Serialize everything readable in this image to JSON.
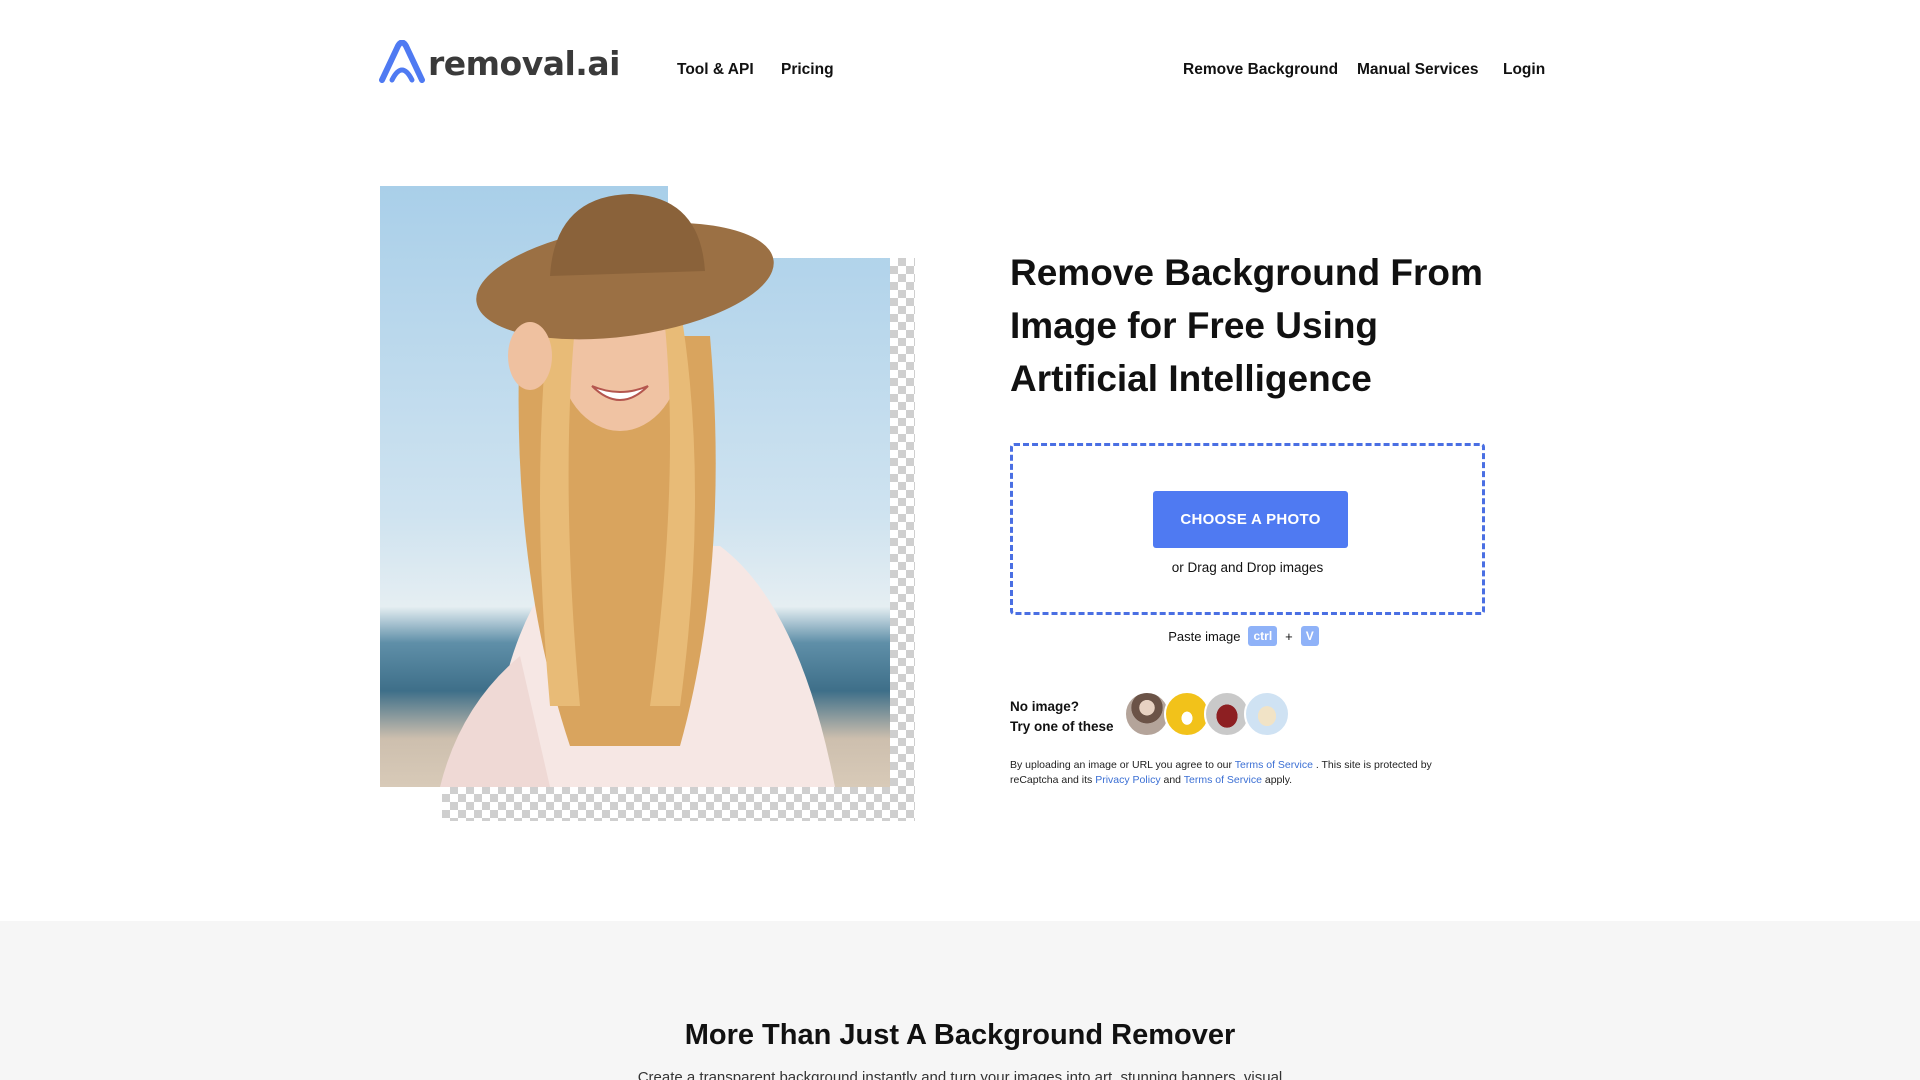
{
  "header": {
    "logo_text": "removal.ai",
    "nav_left": [
      "Tool & API",
      "Pricing"
    ],
    "nav_right": [
      "Remove Background",
      "Manual Services",
      "Login"
    ]
  },
  "hero": {
    "title": "Remove Background From Image for Free Using Artificial Intelligence",
    "choose_button": "CHOOSE A PHOTO",
    "drag_text": "or Drag and Drop images",
    "paste_label": "Paste image",
    "key_ctrl": "ctrl",
    "key_plus": "+",
    "key_v": "V",
    "no_image_line1": "No image?",
    "no_image_line2": "Try one of these",
    "samples": [
      "man-portrait",
      "white-car",
      "red-backpack",
      "white-dog"
    ],
    "legal": {
      "part1": "By uploading an image or URL you agree to our ",
      "link1": "Terms of Service",
      "part2": " . This site is protected by reCaptcha and its ",
      "link2": "Privacy Policy",
      "part3": " and ",
      "link3": "Terms of Service",
      "part4": " apply."
    }
  },
  "section2": {
    "title": "More Than Just A Background Remover",
    "subtitle": "Create a transparent background instantly and turn your images into art, stunning banners, visual"
  },
  "colors": {
    "accent": "#4f7af2",
    "dropzone_border": "#4a6fe3",
    "key_bg": "#8fb2f8",
    "link": "#3b6fd4",
    "section_bg": "#f6f6f6"
  }
}
